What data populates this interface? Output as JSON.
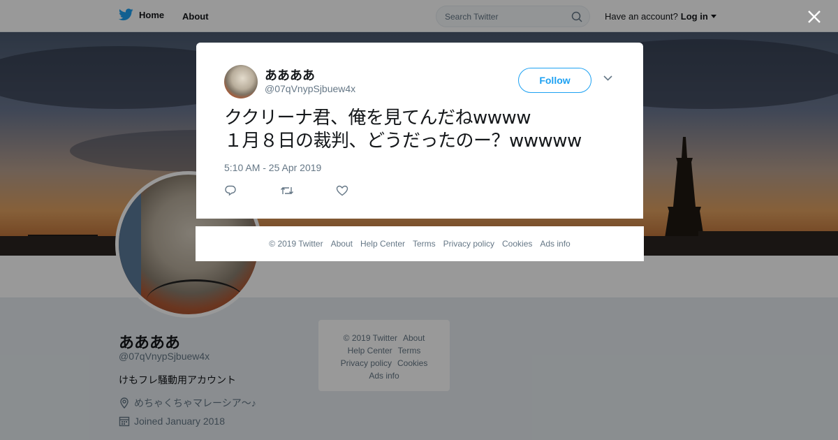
{
  "nav": {
    "home_label": "Home",
    "about_label": "About",
    "search_placeholder": "Search Twitter",
    "account_prompt": "Have an account?",
    "login_label": "Log in"
  },
  "profile": {
    "name": "ああああ",
    "handle": "@07qVnypSjbuew4x",
    "bio": "けもフレ騒動用アカウント",
    "location": "めちゃくちゃマレーシア～♪",
    "joined": "Joined January 2018"
  },
  "side_footer": {
    "links": [
      "© 2019 Twitter",
      "About",
      "Help Center",
      "Terms",
      "Privacy policy",
      "Cookies",
      "Ads info"
    ]
  },
  "tweet": {
    "author_name": "ああああ",
    "author_handle": "@07qVnypSjbuew4x",
    "follow_label": "Follow",
    "text": "ククリーナ君、俺を見てんだねwwww\n１月８日の裁判、どうだったのー？wwwww",
    "timestamp": "5:10 AM - 25 Apr 2019"
  },
  "modal_footer": {
    "links": [
      "© 2019 Twitter",
      "About",
      "Help Center",
      "Terms",
      "Privacy policy",
      "Cookies",
      "Ads info"
    ]
  },
  "icons": {
    "brand": "twitter-bird-icon",
    "search": "search-icon",
    "close": "close-icon",
    "reply": "reply-icon",
    "retweet": "retweet-icon",
    "like": "heart-icon",
    "location": "location-pin-icon",
    "calendar": "calendar-icon",
    "caret": "caret-down-icon",
    "chevron": "chevron-down-icon"
  },
  "colors": {
    "brand": "#1da1f2",
    "text": "#14171a",
    "secondary": "#657786"
  }
}
